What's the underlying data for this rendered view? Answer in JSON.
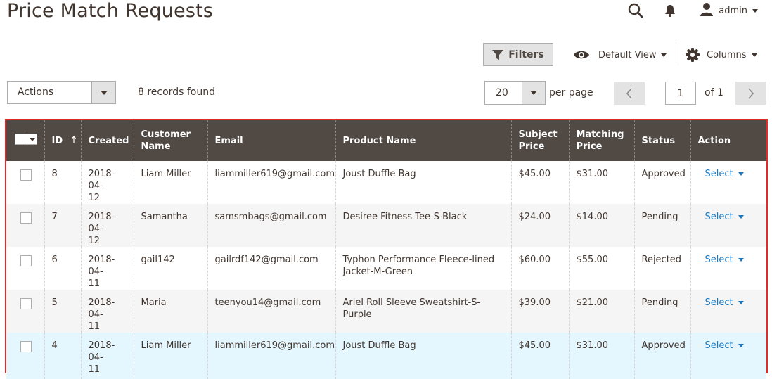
{
  "page": {
    "title": "Price Match Requests"
  },
  "header": {
    "user": "admin"
  },
  "toolbar": {
    "filters_label": "Filters",
    "view_label": "Default View",
    "columns_label": "Columns",
    "actions_label": "Actions",
    "records_found": "8 records found",
    "per_page_value": "20",
    "per_page_label": "per page",
    "current_page": "1",
    "page_of": "of 1"
  },
  "table": {
    "columns": {
      "id": "ID",
      "sort_indicator": "↑",
      "created": "Created",
      "customer_name_l1": "Customer",
      "customer_name_l2": "Name",
      "email": "Email",
      "product_name": "Product Name",
      "subject_price_l1": "Subject",
      "subject_price_l2": "Price",
      "matching_price_l1": "Matching",
      "matching_price_l2": "Price",
      "status": "Status",
      "action": "Action"
    },
    "rows": [
      {
        "id": "8",
        "created_l1": "2018-04-",
        "created_l2": "12",
        "customer": "Liam Miller",
        "email": "liammiller619@gmail.com",
        "product_l1": "Joust Duffle Bag",
        "product_l2": "",
        "subject_price": "$45.00",
        "matching_price": "$31.00",
        "status": "Approved",
        "action": "Select"
      },
      {
        "id": "7",
        "created_l1": "2018-04-",
        "created_l2": "12",
        "customer": "Samantha",
        "email": "samsmbags@gmail.com",
        "product_l1": "Desiree Fitness Tee-S-Black",
        "product_l2": "",
        "subject_price": "$24.00",
        "matching_price": "$14.00",
        "status": "Pending",
        "action": "Select"
      },
      {
        "id": "6",
        "created_l1": "2018-04-",
        "created_l2": "11",
        "customer": "gail142",
        "email": "gailrdf142@gmail.com",
        "product_l1": "Typhon Performance Fleece-lined",
        "product_l2": "Jacket-M-Green",
        "subject_price": "$60.00",
        "matching_price": "$55.00",
        "status": "Rejected",
        "action": "Select"
      },
      {
        "id": "5",
        "created_l1": "2018-04-",
        "created_l2": "11",
        "customer": "Maria",
        "email": "teenyou14@gmail.com",
        "product_l1": "Ariel Roll Sleeve Sweatshirt-S-Purple",
        "product_l2": "",
        "subject_price": "$39.00",
        "matching_price": "$21.00",
        "status": "Pending",
        "action": "Select"
      },
      {
        "id": "4",
        "created_l1": "2018-04-",
        "created_l2": "11",
        "customer": "Liam Miller",
        "email": "liammiller619@gmail.com",
        "product_l1": "Joust Duffle Bag",
        "product_l2": "",
        "subject_price": "$45.00",
        "matching_price": "$31.00",
        "status": "Approved",
        "action": "Select"
      }
    ]
  },
  "icons": {
    "search": "search-icon",
    "bell": "bell-icon",
    "user": "user-icon",
    "filter": "filter-icon",
    "eye": "eye-icon",
    "gear": "gear-icon",
    "prev": "chevron-left-icon",
    "next": "chevron-right-icon"
  },
  "colors": {
    "header_bg": "#514943",
    "highlight_border": "#e02b27",
    "link": "#1979c3",
    "row_hover": "#e5f7fe",
    "row_alt": "#f5f5f5"
  }
}
